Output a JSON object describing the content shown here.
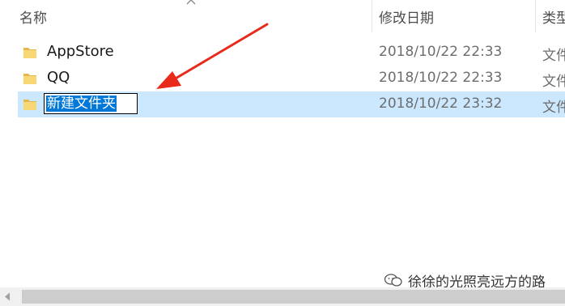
{
  "header": {
    "name_label": "名称",
    "date_label": "修改日期",
    "type_label": "类型"
  },
  "rows": [
    {
      "name": "AppStore",
      "date": "2018/10/22 22:33",
      "type": "文件夹",
      "icon": "folder-icon"
    },
    {
      "name": "QQ",
      "date": "2018/10/22 22:33",
      "type": "文件夹",
      "icon": "folder-icon"
    },
    {
      "name": "新建文件夹",
      "date": "2018/10/22 23:32",
      "type": "文件夹",
      "icon": "folder-icon",
      "state": "renaming"
    }
  ],
  "watermark": {
    "text": "徐徐的光照亮远方的路",
    "icon": "wechat-icon"
  },
  "colors": {
    "selected_row": "#cce8ff",
    "text_selection": "#0078d7",
    "annotation_arrow": "#e8291c",
    "folder": "#f8d775"
  }
}
